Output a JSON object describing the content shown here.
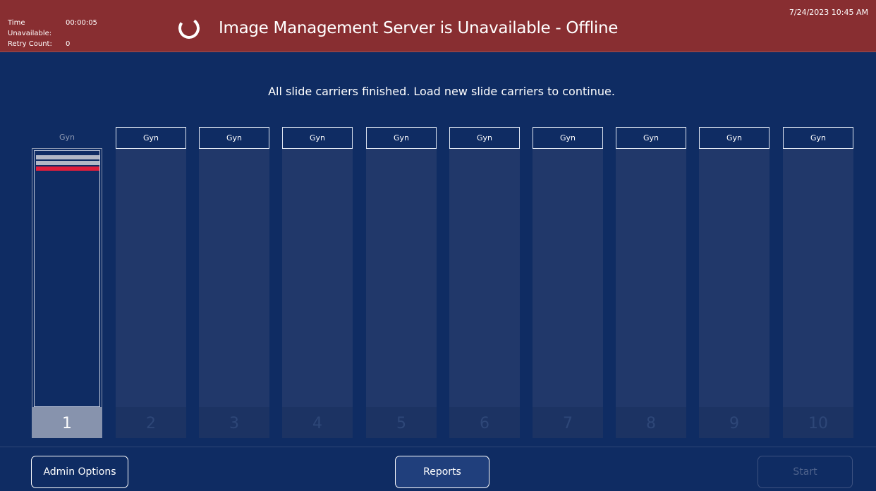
{
  "header": {
    "time_unavailable_label": "Time Unavailable:",
    "time_unavailable_value": "00:00:05",
    "retry_count_label": "Retry Count:",
    "retry_count_value": "0",
    "title": "Image Management Server is Unavailable - Offline",
    "datetime": "7/24/2023 10:45 AM",
    "status_icon": "loading-spinner-icon"
  },
  "message": "All slide carriers finished. Load new slide carriers to continue.",
  "carriers": [
    {
      "label": "Gyn",
      "number": "1",
      "active": true
    },
    {
      "label": "Gyn",
      "number": "2"
    },
    {
      "label": "Gyn",
      "number": "3"
    },
    {
      "label": "Gyn",
      "number": "4"
    },
    {
      "label": "Gyn",
      "number": "5"
    },
    {
      "label": "Gyn",
      "number": "6"
    },
    {
      "label": "Gyn",
      "number": "7"
    },
    {
      "label": "Gyn",
      "number": "8"
    },
    {
      "label": "Gyn",
      "number": "9"
    },
    {
      "label": "Gyn",
      "number": "10"
    }
  ],
  "footer": {
    "admin_label": "Admin Options",
    "reports_label": "Reports",
    "start_label": "Start"
  },
  "colors": {
    "background": "#0f2c63",
    "header_bg": "#882e31",
    "slide_processed": "#b2b8c6",
    "slide_error": "#e01e3c"
  }
}
